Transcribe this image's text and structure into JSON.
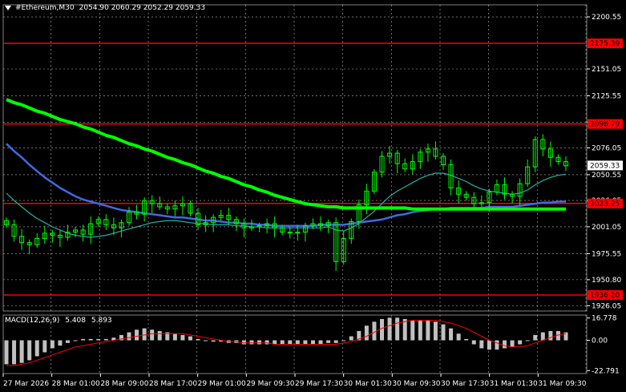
{
  "header": {
    "symbol": "#Ethereum,M30",
    "ohlc": [
      "2054.90",
      "2060.29",
      "2052.29",
      "2059.33"
    ]
  },
  "price_axis": {
    "ticks": [
      2200.55,
      2125.55,
      2100.55,
      2076.05,
      2050.55,
      2001.05,
      1975.55,
      1950.8,
      1926.05
    ],
    "labels": [
      "2200.55",
      "2125.55",
      "2100.55",
      "2076.05",
      "2050.55",
      "2001.05",
      "1975.55",
      "1950.80",
      "1926.05"
    ],
    "extra_ticks": [
      2151.05,
      2026.05
    ],
    "extra_labels": [
      "2151.05",
      "2026.05"
    ]
  },
  "levels": [
    {
      "value": 2175.39,
      "label": "2175.39"
    },
    {
      "value": 2098.79,
      "label": "2098.79"
    },
    {
      "value": 2023.25,
      "label": "2023.25"
    },
    {
      "value": 1936.2,
      "label": "1936.20"
    }
  ],
  "current_price": {
    "value": 2059.33,
    "label": "2059.33"
  },
  "time_axis": {
    "labels": [
      "27 Mar 2026",
      "28 Mar 01:00",
      "28 Mar 09:00",
      "28 Mar 17:00",
      "29 Mar 01:00",
      "29 Mar 09:30",
      "29 Mar 17:30",
      "30 Mar 01:30",
      "30 Mar 09:30",
      "30 Mar 17:30",
      "31 Mar 01:30",
      "31 Mar 09:30"
    ]
  },
  "macd": {
    "title": "MACD(12,26,9)",
    "values": [
      "5.408",
      "5.893"
    ],
    "axis_labels": [
      "16.778",
      "0.00",
      "-22.791"
    ],
    "axis_values": [
      16.778,
      0,
      -22.791
    ]
  },
  "colors": {
    "background": "#000000",
    "grid": "#ffffff",
    "level": "#ff0000",
    "candles": "#00ff00",
    "ma_slow": "#00ff00",
    "ma_mid": "#4169e1",
    "ma_fast": "#20b2aa",
    "macd_hist": "#c0c0c0",
    "macd_signal": "#ff0000"
  },
  "chart_data": {
    "type": "candlestick",
    "price_close": [
      2003,
      1992,
      1986,
      1984,
      1990,
      1995,
      1993,
      1991,
      1996,
      1998,
      1994,
      2004,
      2008,
      2003,
      2000,
      2005,
      2015,
      2013,
      2026,
      2023,
      2020,
      2018,
      2021,
      2023,
      2014,
      2003,
      2005,
      2010,
      2012,
      2008,
      2004,
      2000,
      2001,
      2002,
      2004,
      2000,
      1996,
      1995,
      1996,
      2002,
      2004,
      2002,
      2005,
      1968,
      1990,
      2006,
      2022,
      2035,
      2053,
      2068,
      2071,
      2061,
      2056,
      2063,
      2072,
      2075,
      2068,
      2060,
      2038,
      2032,
      2029,
      2023,
      2024,
      2034,
      2041,
      2032,
      2030,
      2042,
      2058,
      2084,
      2075,
      2067,
      2063,
      2059
    ],
    "ma_slow": [
      2122,
      2119,
      2117,
      2114,
      2111,
      2109,
      2106,
      2103,
      2101,
      2099,
      2096,
      2094,
      2091,
      2088,
      2086,
      2083,
      2080,
      2078,
      2075,
      2073,
      2070,
      2067,
      2065,
      2062,
      2060,
      2057,
      2054,
      2052,
      2049,
      2047,
      2044,
      2041,
      2039,
      2036,
      2034,
      2031,
      2029,
      2027,
      2025,
      2023,
      2022,
      2021,
      2020,
      2020,
      2019,
      2019,
      2019,
      2019,
      2019,
      2019,
      2019,
      2019,
      2019,
      2018,
      2018,
      2018,
      2018,
      2018,
      2018,
      2018,
      2018,
      2018,
      2018,
      2018,
      2018,
      2018,
      2018,
      2018,
      2018,
      2018,
      2018,
      2018,
      2018,
      2018
    ],
    "ma_mid": [
      2080,
      2073,
      2067,
      2060,
      2054,
      2048,
      2043,
      2038,
      2034,
      2030,
      2027,
      2025,
      2023,
      2021,
      2019,
      2017,
      2016,
      2015,
      2014,
      2013,
      2012,
      2011,
      2010,
      2010,
      2009,
      2008,
      2007,
      2007,
      2006,
      2005,
      2005,
      2004,
      2004,
      2003,
      2003,
      2002,
      2002,
      2002,
      2002,
      2002,
      2002,
      2003,
      2003,
      2003,
      2003,
      2004,
      2005,
      2006,
      2007,
      2008,
      2010,
      2012,
      2013,
      2015,
      2016,
      2017,
      2018,
      2018,
      2019,
      2019,
      2019,
      2019,
      2019,
      2020,
      2020,
      2020,
      2020,
      2021,
      2022,
      2023,
      2024,
      2024,
      2025,
      2025
    ],
    "ma_fast": [
      2033,
      2026,
      2020,
      2014,
      2009,
      2005,
      2001,
      1998,
      1995,
      1993,
      1992,
      1991,
      1992,
      1993,
      1995,
      1997,
      1999,
      2001,
      2003,
      2005,
      2006,
      2007,
      2007,
      2006,
      2005,
      2004,
      2004,
      2003,
      2003,
      2003,
      2002,
      2002,
      2001,
      2001,
      2000,
      2000,
      2000,
      2000,
      2000,
      2000,
      2000,
      2000,
      2001,
      1998,
      1997,
      2000,
      2004,
      2010,
      2016,
      2023,
      2030,
      2035,
      2039,
      2043,
      2047,
      2050,
      2052,
      2052,
      2050,
      2047,
      2044,
      2040,
      2037,
      2035,
      2034,
      2033,
      2032,
      2033,
      2036,
      2041,
      2045,
      2048,
      2050,
      2051
    ],
    "macd_hist": [
      -18,
      -18,
      -17,
      -15,
      -12,
      -9,
      -6,
      -4,
      -2,
      0,
      1,
      1,
      1,
      1,
      2,
      4,
      6,
      8,
      9,
      8,
      7,
      6,
      5,
      4,
      3,
      1,
      0,
      -1,
      -1,
      -2,
      -2,
      -3,
      -3,
      -3,
      -3,
      -3,
      -3,
      -3,
      -3,
      -3,
      -3,
      -3,
      -2,
      -2,
      0,
      3,
      7,
      11,
      14,
      16,
      17,
      17,
      16,
      15,
      15,
      15,
      14,
      12,
      9,
      5,
      1,
      -3,
      -6,
      -7,
      -7,
      -6,
      -5,
      -3,
      0,
      4,
      6,
      7,
      7,
      6
    ],
    "macd_signal": [
      -19,
      -19,
      -18,
      -17,
      -15,
      -13,
      -11,
      -9,
      -7,
      -5,
      -4,
      -3,
      -2,
      -1,
      0,
      1,
      2,
      3,
      4,
      5,
      5,
      5,
      5,
      5,
      4,
      3,
      2,
      1,
      0,
      -1,
      -1,
      -2,
      -2,
      -2,
      -2,
      -3,
      -3,
      -3,
      -3,
      -3,
      -3,
      -3,
      -3,
      -3,
      -2,
      -1,
      1,
      3,
      6,
      9,
      11,
      13,
      14,
      15,
      15,
      15,
      15,
      14,
      13,
      11,
      9,
      6,
      3,
      0,
      -2,
      -4,
      -5,
      -5,
      -4,
      -2,
      0,
      2,
      4,
      5
    ]
  }
}
